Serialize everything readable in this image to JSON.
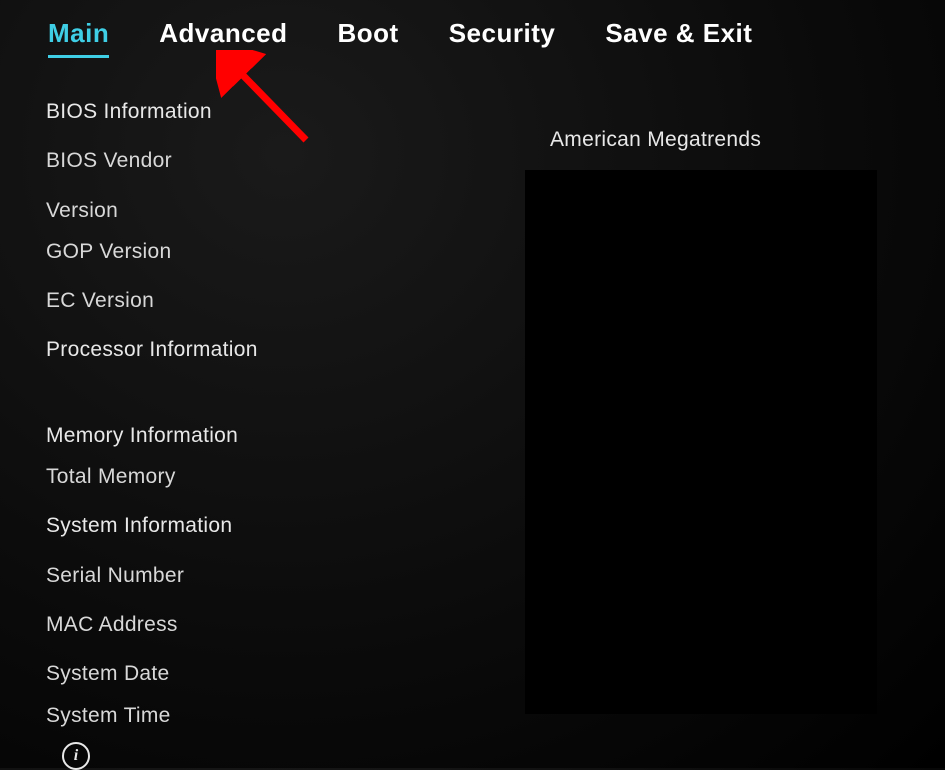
{
  "tabs": {
    "main": "Main",
    "advanced": "Advanced",
    "boot": "Boot",
    "security": "Security",
    "save_exit": "Save & Exit"
  },
  "left": {
    "bios_information": "BIOS Information",
    "bios_vendor": "BIOS Vendor",
    "version": "Version",
    "gop_version": "GOP Version",
    "ec_version": "EC Version",
    "processor_information": "Processor Information",
    "memory_information": "Memory Information",
    "total_memory": "Total Memory",
    "system_information": "System Information",
    "serial_number": "Serial Number",
    "mac_address": "MAC Address",
    "system_date": "System Date",
    "system_time": "System Time"
  },
  "right": {
    "vendor_value": "American Megatrends"
  },
  "info_glyph": "i"
}
